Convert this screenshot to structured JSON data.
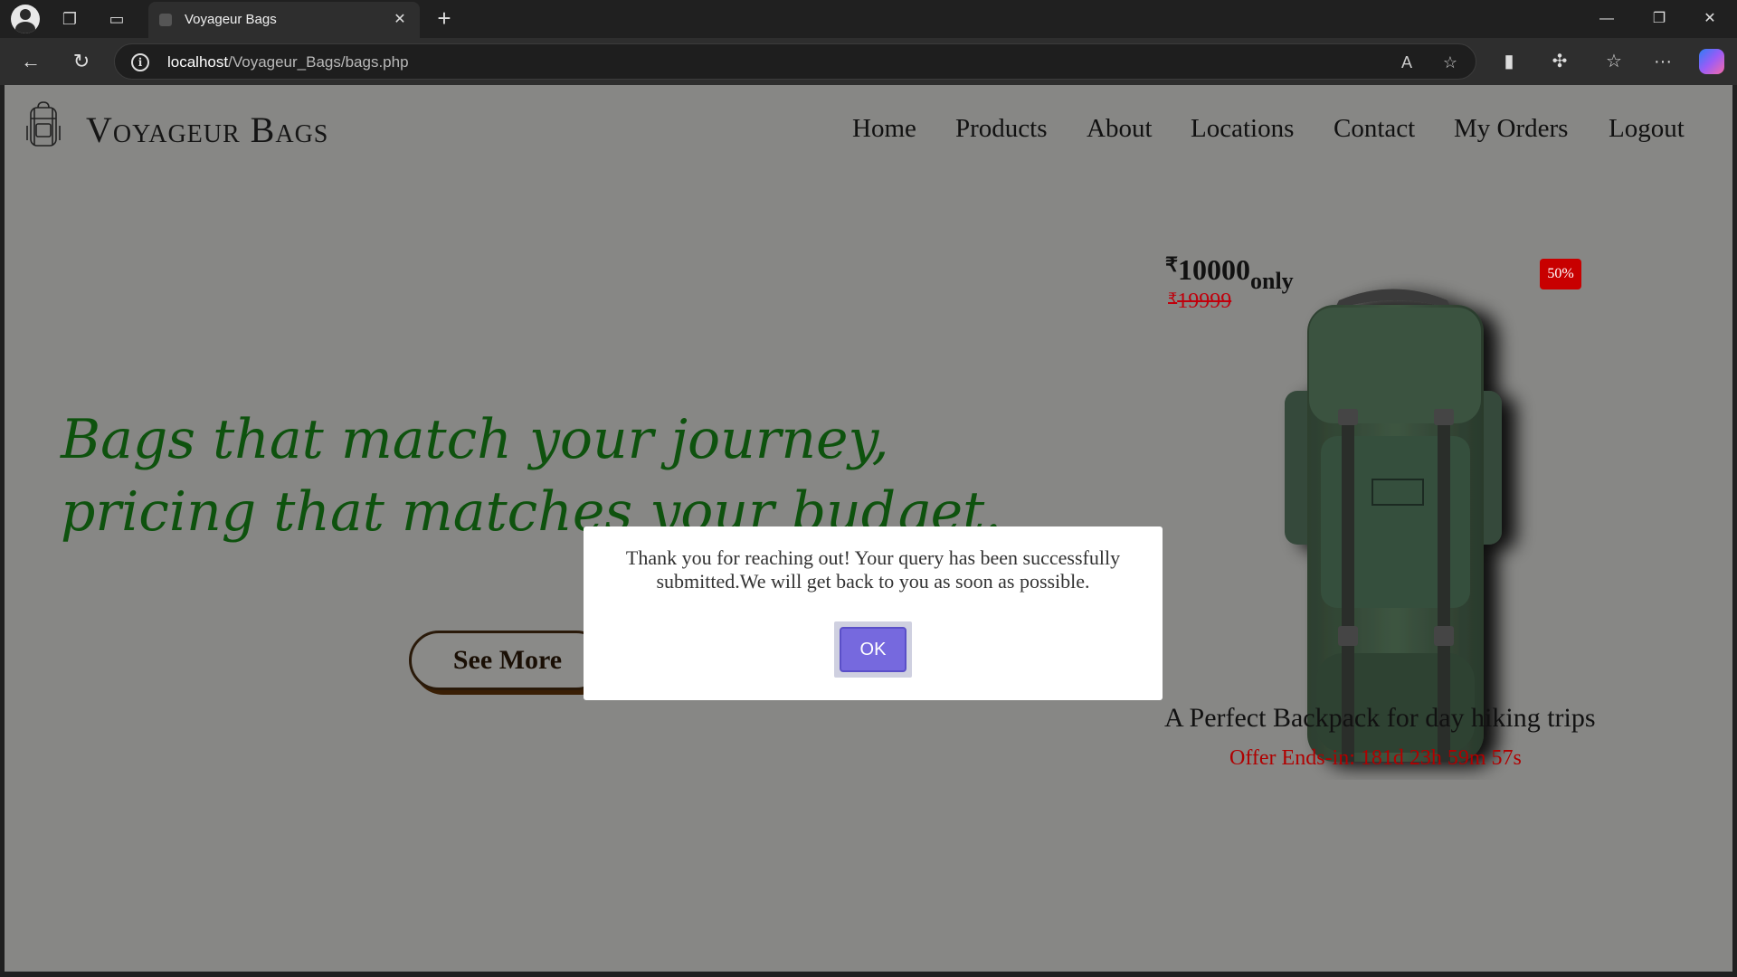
{
  "browser": {
    "tab_title": "Voyageur Bags",
    "url_host": "localhost",
    "url_path": "/Voyageur_Bags/bags.php"
  },
  "site": {
    "brand": "Voyageur Bags",
    "nav": [
      "Home",
      "Products",
      "About",
      "Locations",
      "Contact",
      "My Orders",
      "Logout"
    ]
  },
  "hero": {
    "line1": "Bags that match your journey,",
    "line2": "pricing that matches your budget.",
    "button": "See More"
  },
  "product": {
    "currency": "₹",
    "price": "10000",
    "price_suffix": "only",
    "old_price": "19999",
    "discount_badge": "50%",
    "caption": "A Perfect Backpack for day hiking trips",
    "offer_label": "Offer Ends-in:",
    "offer_countdown": "181d 23h 59m 57s"
  },
  "dialog": {
    "message": "Thank you for reaching out! Your query has been successfully submitted.We will get back to you as soon as possible.",
    "ok_label": "OK"
  },
  "colors": {
    "page_bg": "#878785",
    "hero_text": "#0e520e",
    "price_old": "#c0000c",
    "badge": "#c80000",
    "ok_button": "#7669de"
  }
}
